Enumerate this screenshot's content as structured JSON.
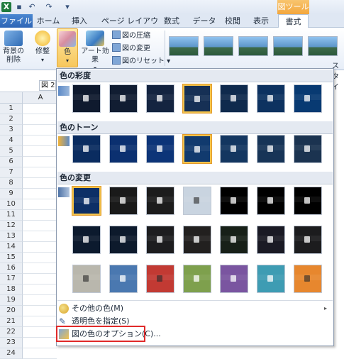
{
  "app": {
    "qat": {
      "icons": [
        "excel-icon",
        "save-icon",
        "undo-icon",
        "redo-icon",
        "qat-menu-icon"
      ]
    },
    "context_group": "図ツール",
    "tabs": [
      {
        "label": "ファイル"
      },
      {
        "label": "ホーム"
      },
      {
        "label": "挿入"
      },
      {
        "label": "ページ レイアウト"
      },
      {
        "label": "数式"
      },
      {
        "label": "データ"
      },
      {
        "label": "校閲"
      },
      {
        "label": "表示"
      },
      {
        "label": "書式"
      }
    ],
    "ribbon": {
      "remove_bg": "背景の\n削除",
      "corrections": "修整",
      "color": "色",
      "artistic": "アート効果",
      "compress": "図の圧縮",
      "change": "図の変更",
      "reset": "図のリセット",
      "style_suffix": "スタイ"
    },
    "namebox": "図 2",
    "col_a": "A",
    "rows": [
      "1",
      "2",
      "3",
      "4",
      "5",
      "6",
      "7",
      "8",
      "9",
      "10",
      "11",
      "12",
      "13",
      "14",
      "15",
      "16",
      "17",
      "18",
      "19",
      "20",
      "21",
      "22",
      "23",
      "24"
    ]
  },
  "gallery": {
    "sections": [
      {
        "title": "色の彩度"
      },
      {
        "title": "色のトーン"
      },
      {
        "title": "色の変更"
      }
    ],
    "saturation_swatches": [
      "#0f1a2e",
      "#111d32",
      "#142440",
      "#163055",
      "#0f2a4d",
      "#0d3260",
      "#083a72"
    ],
    "tone_swatches": [
      "#0a2c60",
      "#0b3070",
      "#0c3478",
      "#113a6e",
      "#133660",
      "#173457",
      "#1b3350"
    ],
    "recolor_row1": [
      "#0d2f66",
      "#1a1a1a",
      "#1c1c1c",
      "#c9d4e0",
      "#000000",
      "#000000",
      "#000000"
    ],
    "recolor_row2": [
      "#0c1a2e",
      "#0d1a2c",
      "#1d1d1f",
      "#22201f",
      "#172018",
      "#1a1a24",
      "#1c1c1e"
    ],
    "recolor_row3": [
      "#b9b7ad",
      "#4a78b0",
      "#c23a33",
      "#7ea04d",
      "#7a55a0",
      "#3e9cb3",
      "#e7872e"
    ],
    "menu": {
      "more_colors": "その他の色(M)",
      "set_transparent": "透明色を指定(S)",
      "color_options": "図の色のオプション(C)..."
    }
  }
}
